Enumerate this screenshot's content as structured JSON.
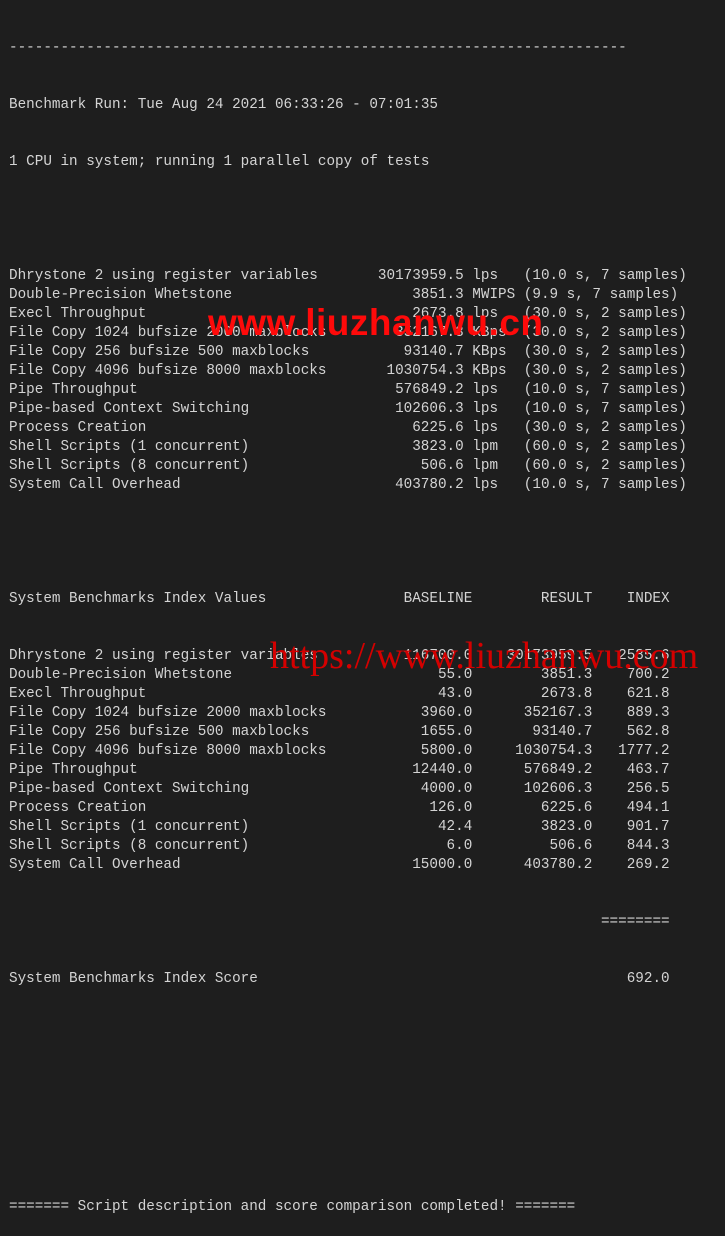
{
  "terminal": {
    "separator": "------------------------------------------------------------------------",
    "run_line": "Benchmark Run: Tue Aug 24 2021 06:33:26 - 07:01:35",
    "cpu_line": "1 CPU in system; running 1 parallel copy of tests",
    "results": [
      {
        "name": "Dhrystone 2 using register variables",
        "value": "30173959.5",
        "unit": "lps",
        "detail": "(10.0 s, 7 samples)"
      },
      {
        "name": "Double-Precision Whetstone",
        "value": "3851.3",
        "unit": "MWIPS",
        "detail": "(9.9 s, 7 samples)"
      },
      {
        "name": "Execl Throughput",
        "value": "2673.8",
        "unit": "lps",
        "detail": "(30.0 s, 2 samples)"
      },
      {
        "name": "File Copy 1024 bufsize 2000 maxblocks",
        "value": "352167.3",
        "unit": "KBps",
        "detail": "(30.0 s, 2 samples)"
      },
      {
        "name": "File Copy 256 bufsize 500 maxblocks",
        "value": "93140.7",
        "unit": "KBps",
        "detail": "(30.0 s, 2 samples)"
      },
      {
        "name": "File Copy 4096 bufsize 8000 maxblocks",
        "value": "1030754.3",
        "unit": "KBps",
        "detail": "(30.0 s, 2 samples)"
      },
      {
        "name": "Pipe Throughput",
        "value": "576849.2",
        "unit": "lps",
        "detail": "(10.0 s, 7 samples)"
      },
      {
        "name": "Pipe-based Context Switching",
        "value": "102606.3",
        "unit": "lps",
        "detail": "(10.0 s, 7 samples)"
      },
      {
        "name": "Process Creation",
        "value": "6225.6",
        "unit": "lps",
        "detail": "(30.0 s, 2 samples)"
      },
      {
        "name": "Shell Scripts (1 concurrent)",
        "value": "3823.0",
        "unit": "lpm",
        "detail": "(60.0 s, 2 samples)"
      },
      {
        "name": "Shell Scripts (8 concurrent)",
        "value": "506.6",
        "unit": "lpm",
        "detail": "(60.0 s, 2 samples)"
      },
      {
        "name": "System Call Overhead",
        "value": "403780.2",
        "unit": "lps",
        "detail": "(10.0 s, 7 samples)"
      }
    ],
    "index_header": {
      "name": "System Benchmarks Index Values",
      "baseline": "BASELINE",
      "result": "RESULT",
      "index": "INDEX"
    },
    "index_rows": [
      {
        "name": "Dhrystone 2 using register variables",
        "baseline": "116700.0",
        "result": "30173959.5",
        "index": "2585.6"
      },
      {
        "name": "Double-Precision Whetstone",
        "baseline": "55.0",
        "result": "3851.3",
        "index": "700.2"
      },
      {
        "name": "Execl Throughput",
        "baseline": "43.0",
        "result": "2673.8",
        "index": "621.8"
      },
      {
        "name": "File Copy 1024 bufsize 2000 maxblocks",
        "baseline": "3960.0",
        "result": "352167.3",
        "index": "889.3"
      },
      {
        "name": "File Copy 256 bufsize 500 maxblocks",
        "baseline": "1655.0",
        "result": "93140.7",
        "index": "562.8"
      },
      {
        "name": "File Copy 4096 bufsize 8000 maxblocks",
        "baseline": "5800.0",
        "result": "1030754.3",
        "index": "1777.2"
      },
      {
        "name": "Pipe Throughput",
        "baseline": "12440.0",
        "result": "576849.2",
        "index": "463.7"
      },
      {
        "name": "Pipe-based Context Switching",
        "baseline": "4000.0",
        "result": "102606.3",
        "index": "256.5"
      },
      {
        "name": "Process Creation",
        "baseline": "126.0",
        "result": "6225.6",
        "index": "494.1"
      },
      {
        "name": "Shell Scripts (1 concurrent)",
        "baseline": "42.4",
        "result": "3823.0",
        "index": "901.7"
      },
      {
        "name": "Shell Scripts (8 concurrent)",
        "baseline": "6.0",
        "result": "506.6",
        "index": "844.3"
      },
      {
        "name": "System Call Overhead",
        "baseline": "15000.0",
        "result": "403780.2",
        "index": "269.2"
      }
    ],
    "score_rule": "========",
    "score_label": "System Benchmarks Index Score",
    "score_value": "692.0",
    "footer": "======= Script description and score comparison completed! ======="
  },
  "watermarks": {
    "top": "www.liuzhanwu.cn",
    "bottom": "https://www.liuzhanwu.com"
  },
  "colors": {
    "background": "#1e1e1e",
    "text": "#d4d4d4",
    "watermark_top": "#ff0a0a",
    "watermark_bottom": "#d40000"
  }
}
